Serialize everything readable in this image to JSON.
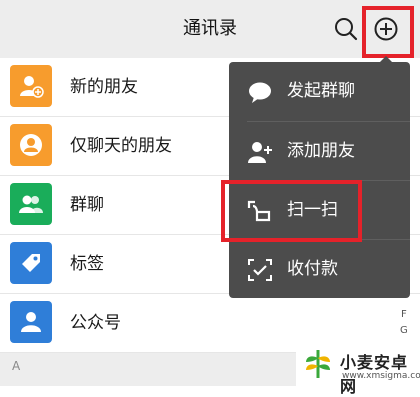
{
  "header": {
    "title": "通讯录"
  },
  "contacts": [
    {
      "label": "新的朋友",
      "icon": "add-friend-icon",
      "color": "#f79c2d"
    },
    {
      "label": "仅聊天的朋友",
      "icon": "chat-only-friend-icon",
      "color": "#f79c2d"
    },
    {
      "label": "群聊",
      "icon": "group-chat-icon",
      "color": "#1aad5a"
    },
    {
      "label": "标签",
      "icon": "tag-icon",
      "color": "#2f7ed8"
    },
    {
      "label": "公众号",
      "icon": "official-account-icon",
      "color": "#2f7ed8"
    }
  ],
  "section": {
    "label": "A"
  },
  "index": [
    "F",
    "G"
  ],
  "menu": {
    "items": [
      {
        "label": "发起群聊",
        "icon": "chat-bubble-icon"
      },
      {
        "label": "添加朋友",
        "icon": "add-person-icon"
      },
      {
        "label": "扫一扫",
        "icon": "scan-icon"
      },
      {
        "label": "收付款",
        "icon": "payment-icon"
      }
    ]
  },
  "watermark": {
    "title": "小麦安卓网",
    "url": "www.xmsigma.com"
  },
  "colors": {
    "highlight": "#e5222a",
    "menu_bg": "#4c4c4c",
    "header_bg": "#ededed"
  }
}
